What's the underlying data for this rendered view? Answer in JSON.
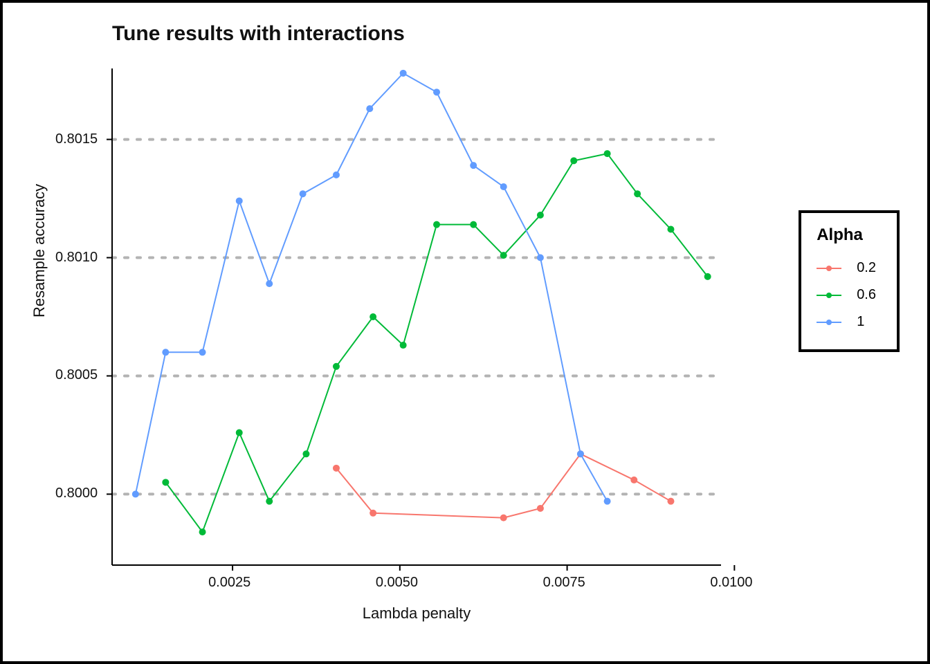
{
  "title": "Tune results with interactions",
  "xlabel": "Lambda penalty",
  "ylabel": "Resample accuracy",
  "legend": {
    "title": "Alpha",
    "items": [
      {
        "label": "0.2",
        "color": "#F8766D"
      },
      {
        "label": "0.6",
        "color": "#00BA38"
      },
      {
        "label": "1",
        "color": "#619CFF"
      }
    ]
  },
  "chart_data": {
    "type": "line",
    "xlabel": "Lambda penalty",
    "ylabel": "Resample accuracy",
    "title": "Tune results with interactions",
    "xlim": [
      0.0007,
      0.0098
    ],
    "ylim": [
      0.7997,
      0.8018
    ],
    "x_ticks": [
      0.0025,
      0.005,
      0.0075,
      0.01
    ],
    "y_ticks": [
      0.8,
      0.8005,
      0.801,
      0.8015
    ],
    "x_tick_labels": [
      "0.0025",
      "0.0050",
      "0.0075",
      "0.0100"
    ],
    "y_tick_labels": [
      "0.8000",
      "0.8005",
      "0.8010",
      "0.8015"
    ],
    "series": [
      {
        "name": "0.2",
        "color": "#F8766D",
        "points": [
          {
            "x": 0.00405,
            "y": 0.80011
          },
          {
            "x": 0.0046,
            "y": 0.79992
          },
          {
            "x": 0.00655,
            "y": 0.7999
          },
          {
            "x": 0.0071,
            "y": 0.79994
          },
          {
            "x": 0.0077,
            "y": 0.80017
          },
          {
            "x": 0.0085,
            "y": 0.80006
          },
          {
            "x": 0.00905,
            "y": 0.79997
          }
        ]
      },
      {
        "name": "0.6",
        "color": "#00BA38",
        "points": [
          {
            "x": 0.0015,
            "y": 0.80005
          },
          {
            "x": 0.00205,
            "y": 0.79984
          },
          {
            "x": 0.0026,
            "y": 0.80026
          },
          {
            "x": 0.00305,
            "y": 0.79997
          },
          {
            "x": 0.0036,
            "y": 0.80017
          },
          {
            "x": 0.00405,
            "y": 0.80054
          },
          {
            "x": 0.0046,
            "y": 0.80075
          },
          {
            "x": 0.00505,
            "y": 0.80063
          },
          {
            "x": 0.00555,
            "y": 0.80114
          },
          {
            "x": 0.0061,
            "y": 0.80114
          },
          {
            "x": 0.00655,
            "y": 0.80101
          },
          {
            "x": 0.0071,
            "y": 0.80118
          },
          {
            "x": 0.0076,
            "y": 0.80141
          },
          {
            "x": 0.0081,
            "y": 0.80144
          },
          {
            "x": 0.00855,
            "y": 0.80127
          },
          {
            "x": 0.00905,
            "y": 0.80112
          },
          {
            "x": 0.0096,
            "y": 0.80092
          }
        ]
      },
      {
        "name": "1",
        "color": "#619CFF",
        "points": [
          {
            "x": 0.00105,
            "y": 0.8
          },
          {
            "x": 0.0015,
            "y": 0.8006
          },
          {
            "x": 0.00205,
            "y": 0.8006
          },
          {
            "x": 0.0026,
            "y": 0.80124
          },
          {
            "x": 0.00305,
            "y": 0.80089
          },
          {
            "x": 0.00355,
            "y": 0.80127
          },
          {
            "x": 0.00405,
            "y": 0.80135
          },
          {
            "x": 0.00455,
            "y": 0.80163
          },
          {
            "x": 0.00505,
            "y": 0.80178
          },
          {
            "x": 0.00555,
            "y": 0.8017
          },
          {
            "x": 0.0061,
            "y": 0.80139
          },
          {
            "x": 0.00655,
            "y": 0.8013
          },
          {
            "x": 0.0071,
            "y": 0.801
          },
          {
            "x": 0.0077,
            "y": 0.80017
          },
          {
            "x": 0.0081,
            "y": 0.79997
          }
        ]
      }
    ]
  }
}
